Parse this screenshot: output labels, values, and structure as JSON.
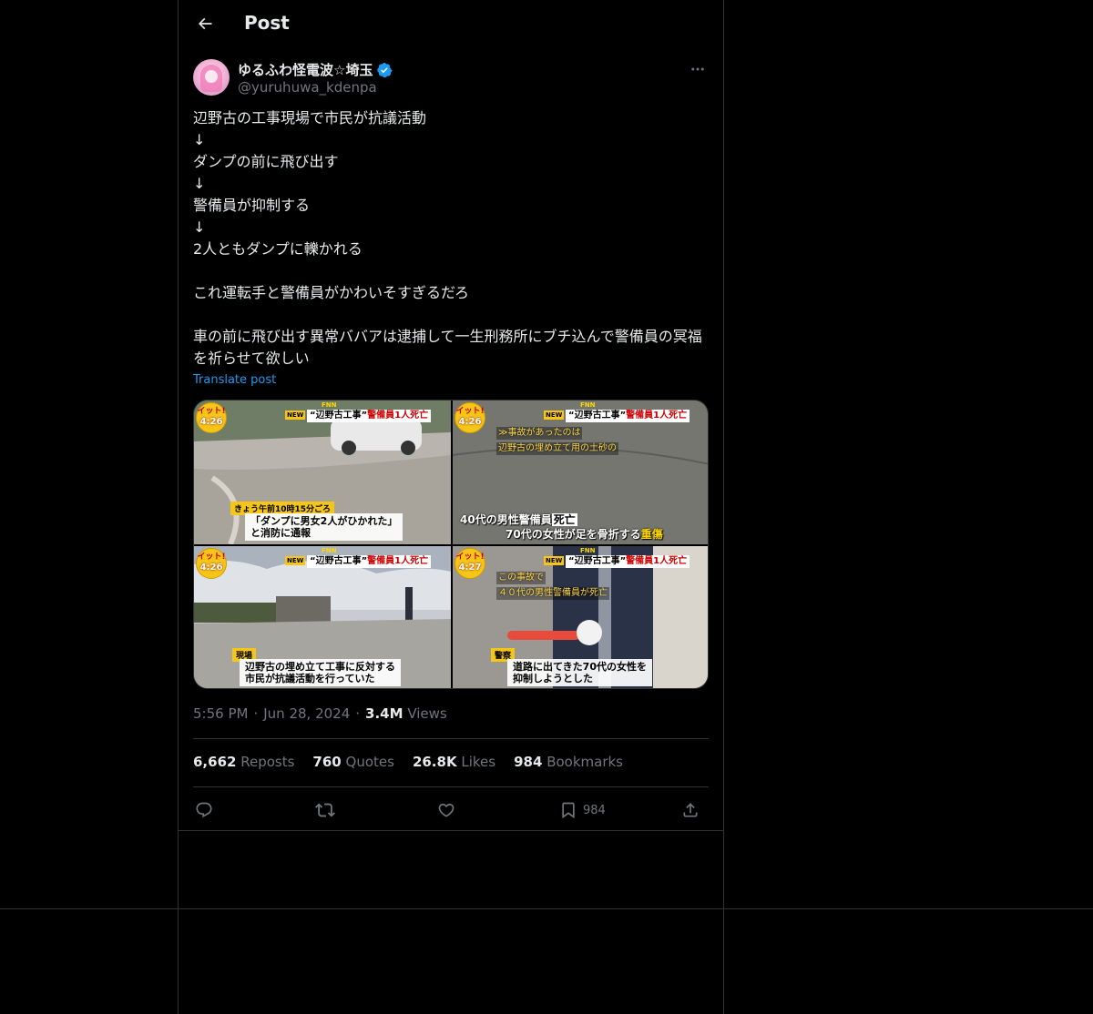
{
  "header": {
    "title": "Post"
  },
  "author": {
    "name": "ゆるふわ怪電波☆埼玉",
    "handle": "@yuruhuwa_kdenpa"
  },
  "post": {
    "text": "辺野古の工事現場で市民が抗議活動\n↓\nダンプの前に飛び出す\n↓\n警備員が抑制する\n↓\n2人ともダンプに轢かれる\n\nこれ運転手と警備員がかわいそすぎるだろ\n\n車の前に飛び出す異常ババアは逮捕して一生刑務所にブチ込んで警備員の冥福を祈らせて欲しい",
    "translate_label": "Translate post"
  },
  "media": {
    "banner_prefix": "“辺野古工事”",
    "banner_suffix": "警備員1人死亡",
    "new_tag": "NEW",
    "fnn": "FNN",
    "badge_show": "イット!",
    "tiles": [
      {
        "time": "4:26",
        "tag": "きょう午前10時15分ごろ",
        "caption_1": "「ダンプに男女2人がひかれた」",
        "caption_2": "と消防に通報"
      },
      {
        "time": "4:26",
        "sub_1": "≫事故があったのは",
        "sub_2": "辺野古の埋め立て用の土砂の",
        "cap_a_pre": "40代の男性警備員",
        "cap_a_box": "死亡",
        "cap_b_pre": "70代の女性が足を骨折する",
        "cap_b_y": "重傷"
      },
      {
        "time": "4:26",
        "tag": "現場",
        "caption_1": "辺野古の埋め立て工事に反対する",
        "caption_2": "市民が抗議活動を行っていた"
      },
      {
        "time": "4:27",
        "sub_1": "この事故で",
        "sub_2": "４０代の男性警備員が死亡",
        "tag": "警察",
        "caption_1": "道路に出てきた70代の女性を",
        "caption_2": "抑制しようとした"
      }
    ]
  },
  "meta": {
    "time": "5:56 PM",
    "date": "Jun 28, 2024",
    "views_count": "3.4M",
    "views_label": "Views",
    "dot": "·"
  },
  "stats": {
    "reposts_count": "6,662",
    "reposts_label": "Reposts",
    "quotes_count": "760",
    "quotes_label": "Quotes",
    "likes_count": "26.8K",
    "likes_label": "Likes",
    "bookmarks_count": "984",
    "bookmarks_label": "Bookmarks"
  },
  "actions": {
    "bookmark_count": "984"
  },
  "colors": {
    "background": "#000000",
    "text": "#e7e9ea",
    "muted": "#71767b",
    "accent": "#1d9bf0",
    "border": "#2f3336"
  }
}
